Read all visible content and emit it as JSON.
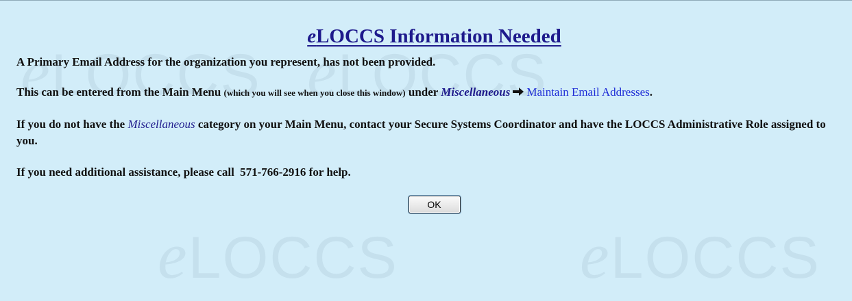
{
  "watermark": {
    "text": "LOCCS",
    "prefix": "e"
  },
  "dialog": {
    "title_prefix": "e",
    "title_rest": "LOCCS Information Needed",
    "para1": "A Primary Email Address for the organization you represent, has not been provided.",
    "para2": {
      "part1": "This can be entered from the Main Menu",
      "note": "(which you will see when you close this window)",
      "part2": "under",
      "menu": "Miscellaneous",
      "link": "Maintain Email Addresses",
      "end": "."
    },
    "para3": {
      "part1": "If you do not have the",
      "menu": "Miscellaneous",
      "part2": "category on your Main Menu, contact your Secure Systems Coordinator and have the LOCCS Administrative Role assigned to you."
    },
    "para4": {
      "part1": "If you need additional assistance, please call",
      "phone": "571-766-2916",
      "part2": "for help."
    },
    "ok_label": "OK"
  },
  "colors": {
    "background": "#d2edf9",
    "title": "#1e1a8c",
    "link": "#1d2bd6",
    "watermark": "#c5e0ed"
  },
  "icons": {
    "arrow": "right-arrow-icon"
  }
}
